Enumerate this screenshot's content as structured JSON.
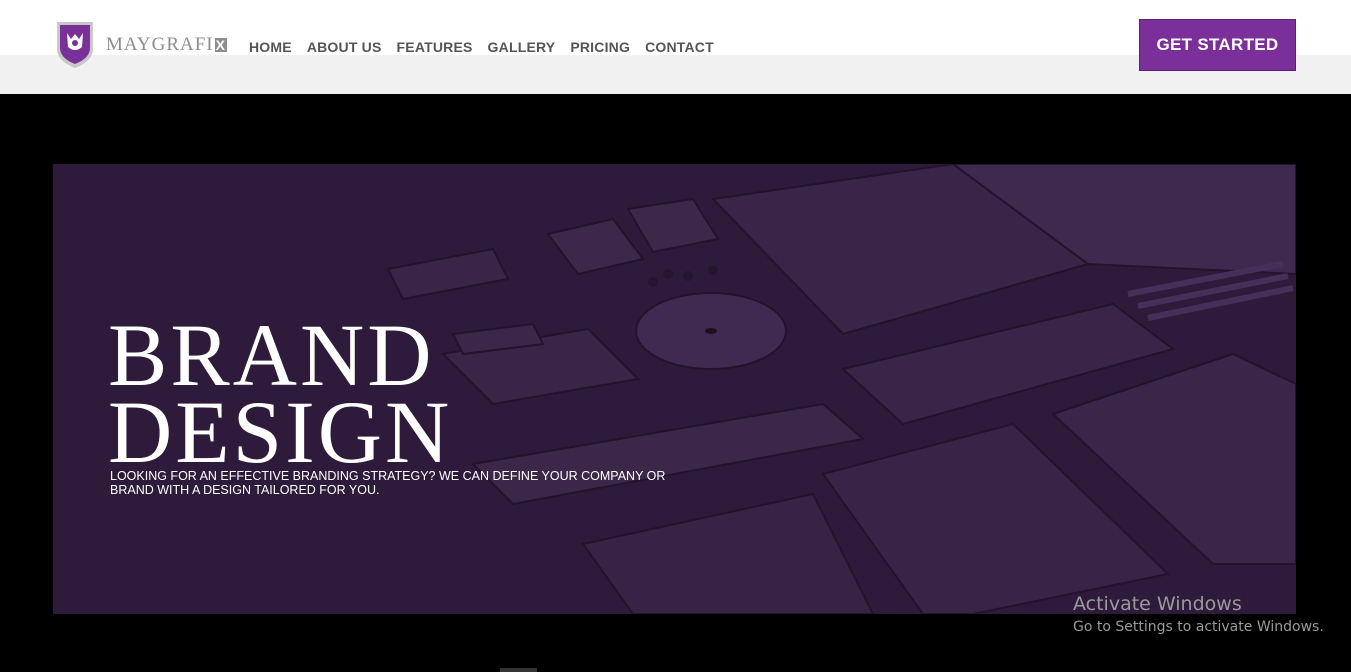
{
  "header": {
    "logo_text": "MAYGRAFI",
    "logo_suffix": "X",
    "nav": [
      "HOME",
      "ABOUT US",
      "FEATURES",
      "GALLERY",
      "PRICING",
      "CONTACT"
    ],
    "cta_label": "GET STARTED"
  },
  "hero": {
    "title_line1": "BRAND",
    "title_line2": "DESIGN",
    "description": "LOOKING FOR AN EFFECTIVE BRANDING STRATEGY? WE CAN DEFINE YOUR COMPANY OR BRAND WITH A  DESIGN TAILORED FOR YOU."
  },
  "watermark": {
    "title": "Activate Windows",
    "subtitle": "Go to Settings to activate Windows."
  },
  "colors": {
    "brand_purple": "#7b2f9a",
    "hero_overlay": "#2e1a3a"
  }
}
